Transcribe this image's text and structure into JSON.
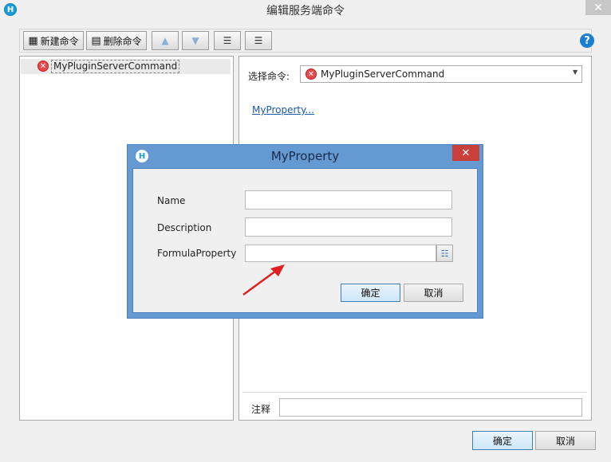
{
  "window": {
    "title": "编辑服务端命令",
    "app_icon": "H",
    "close_glyph": "✕"
  },
  "toolbar": {
    "new_command_label": "新建命令",
    "delete_command_label": "删除命令",
    "help_glyph": "?"
  },
  "tree": {
    "items": [
      {
        "label": "MyPluginServerCommand",
        "icon": "error-icon"
      }
    ]
  },
  "editor": {
    "select_label": "选择命令:",
    "select_value": "MyPluginServerCommand",
    "property_link": "MyProperty...",
    "note_label": "注释",
    "note_value": ""
  },
  "dialog": {
    "title": "MyProperty",
    "close_glyph": "✕",
    "fields": [
      {
        "label": "Name",
        "value": ""
      },
      {
        "label": "Description",
        "value": ""
      },
      {
        "label": "FormulaProperty",
        "value": ""
      }
    ],
    "ok_label": "确定",
    "cancel_label": "取消"
  },
  "footer": {
    "ok_label": "确定",
    "cancel_label": "取消"
  },
  "colors": {
    "dialog_frame": "#6599d1",
    "annotation_arrow": "#e02020",
    "link": "#1a5aa8"
  }
}
